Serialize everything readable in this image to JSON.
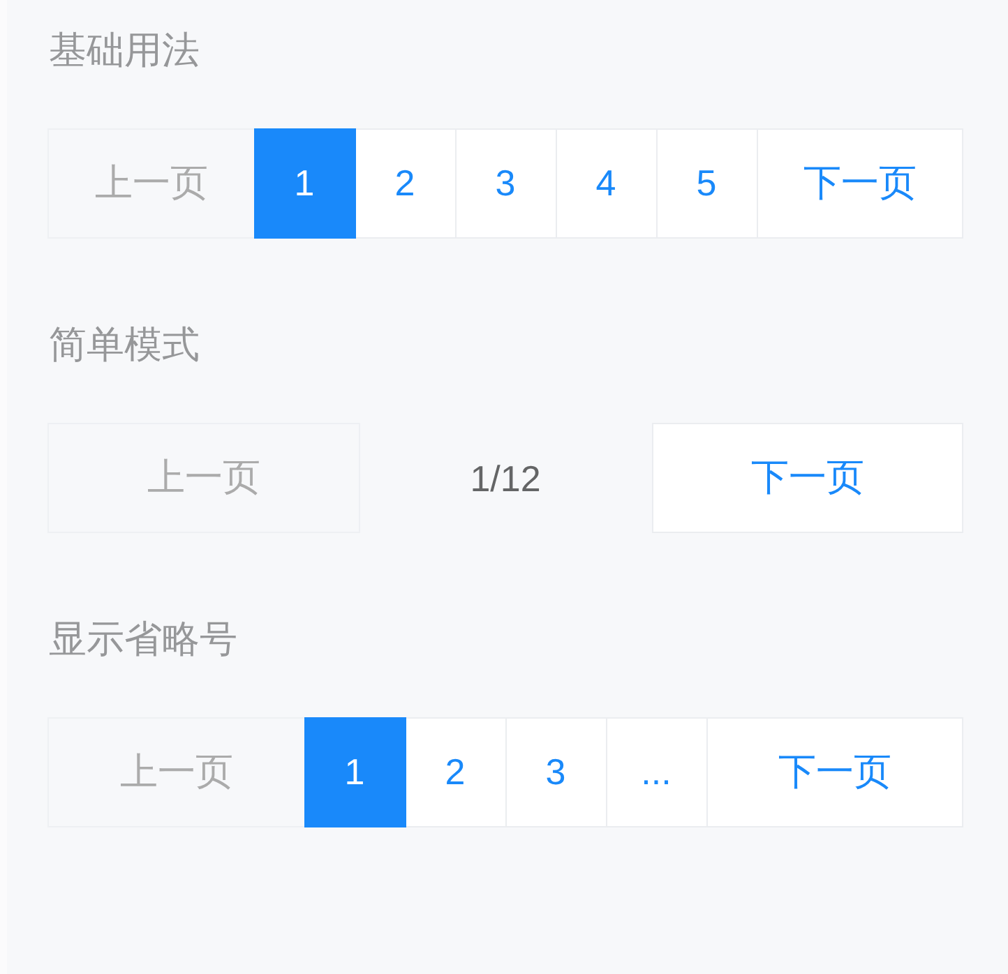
{
  "sections": [
    {
      "title": "基础用法",
      "pagination": {
        "kind": "multi",
        "prev": {
          "label": "上一页",
          "disabled": true
        },
        "pages": [
          {
            "label": "1",
            "selected": true
          },
          {
            "label": "2",
            "selected": false
          },
          {
            "label": "3",
            "selected": false
          },
          {
            "label": "4",
            "selected": false
          },
          {
            "label": "5",
            "selected": false
          }
        ],
        "next": {
          "label": "下一页",
          "disabled": false
        }
      }
    },
    {
      "title": "简单模式",
      "pagination": {
        "kind": "simple",
        "prev": {
          "label": "上一页",
          "disabled": true
        },
        "description": "1/12",
        "next": {
          "label": "下一页",
          "disabled": false
        }
      }
    },
    {
      "title": "显示省略号",
      "pagination": {
        "kind": "multi",
        "prev": {
          "label": "上一页",
          "disabled": true
        },
        "pages": [
          {
            "label": "1",
            "selected": true
          },
          {
            "label": "2",
            "selected": false
          },
          {
            "label": "3",
            "selected": false
          },
          {
            "label": "...",
            "selected": false
          }
        ],
        "next": {
          "label": "下一页",
          "disabled": false
        }
      }
    }
  ]
}
